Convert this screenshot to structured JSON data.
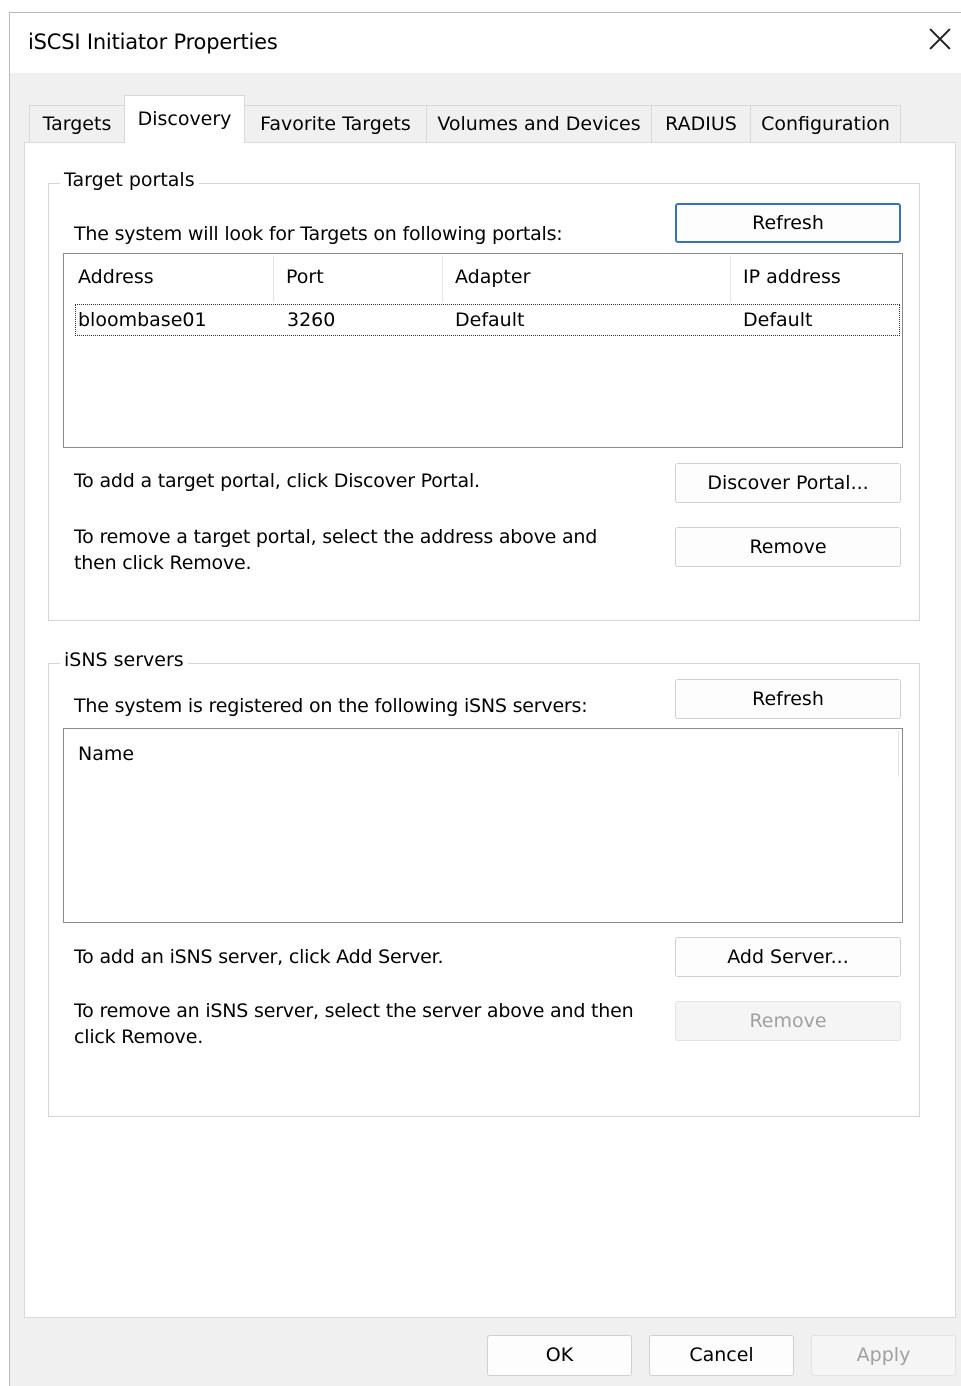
{
  "window": {
    "title": "iSCSI Initiator Properties"
  },
  "tabs": [
    {
      "label": "Targets"
    },
    {
      "label": "Discovery"
    },
    {
      "label": "Favorite Targets"
    },
    {
      "label": "Volumes and Devices"
    },
    {
      "label": "RADIUS"
    },
    {
      "label": "Configuration"
    }
  ],
  "target_portals": {
    "group_title": "Target portals",
    "description": "The system will look for Targets on following portals:",
    "refresh_label": "Refresh",
    "columns": [
      "Address",
      "Port",
      "Adapter",
      "IP address"
    ],
    "rows": [
      {
        "address": "bloombase01",
        "port": "3260",
        "adapter": "Default",
        "ip": "Default"
      }
    ],
    "add_hint": "To add a target portal, click Discover Portal.",
    "discover_label": "Discover Portal...",
    "remove_hint": "To remove a target portal, select the address above and then click Remove.",
    "remove_label": "Remove"
  },
  "isns_servers": {
    "group_title": "iSNS servers",
    "description": "The system is registered on the following iSNS servers:",
    "refresh_label": "Refresh",
    "columns": [
      "Name"
    ],
    "add_hint": "To add an iSNS server, click Add Server.",
    "add_label": "Add Server...",
    "remove_hint": "To remove an iSNS server, select the server above and then click Remove.",
    "remove_label": "Remove"
  },
  "footer": {
    "ok_label": "OK",
    "cancel_label": "Cancel",
    "apply_label": "Apply"
  }
}
